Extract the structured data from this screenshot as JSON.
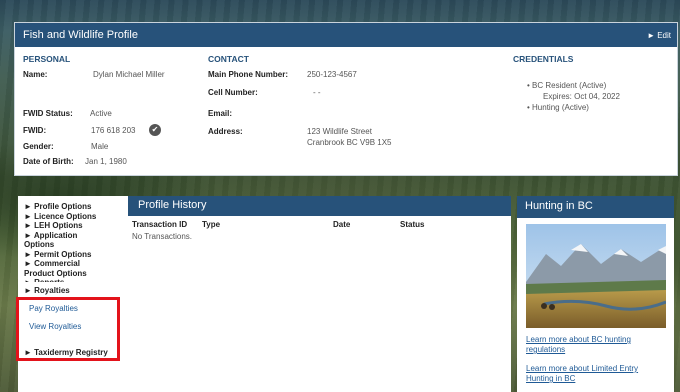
{
  "profile": {
    "title": "Fish and Wildlife Profile",
    "edit_label": "► Edit",
    "personal": {
      "heading": "PERSONAL",
      "name_label": "Name:",
      "name_value": "Dylan Michael Miller",
      "fwid_status_label": "FWID Status:",
      "fwid_status_value": "Active",
      "fwid_label": "FWID:",
      "fwid_value": "176 618 203",
      "gender_label": "Gender:",
      "gender_value": "Male",
      "dob_label": "Date of Birth:",
      "dob_value": "Jan 1, 1980"
    },
    "contact": {
      "heading": "CONTACT",
      "main_phone_label": "Main Phone Number:",
      "main_phone_value": "250-123-4567",
      "cell_label": "Cell Number:",
      "cell_value": "- -",
      "email_label": "Email:",
      "address_label": "Address:",
      "address_line1": "123 Wildlife Street",
      "address_line2": "Cranbrook BC V9B 1X5"
    },
    "credentials": {
      "heading": "CREDENTIALS",
      "item1": "• BC Resident (Active)",
      "item1_sub": "Expires: Oct 04, 2022",
      "item2": "• Hunting (Active)"
    }
  },
  "leftnav": {
    "profile_options": "► Profile Options",
    "licence_options": "► Licence Options",
    "leh_options": "► LEH Options",
    "application_options_1": "► Application",
    "application_options_2": "Options",
    "permit_options": "► Permit Options",
    "commercial_1": "► Commercial",
    "commercial_2": "Product Options",
    "reports": "► Reports",
    "royalties": "► Royalties",
    "pay_royalties": "Pay Royalties",
    "view_royalties": "View Royalties",
    "taxidermy": "► Taxidermy Registry"
  },
  "history": {
    "title": "Profile History",
    "col_transaction_id": "Transaction ID",
    "col_type": "Type",
    "col_date": "Date",
    "col_status": "Status",
    "empty_text": "No Transactions."
  },
  "hunting": {
    "title": "Hunting in BC",
    "link1_line1": "Learn more about BC hunting",
    "link1_line2": "regulations",
    "link2_line1": "Learn more about Limited Entry",
    "link2_line2": "Hunting in BC"
  },
  "colors": {
    "header_blue": "#27527a",
    "link_blue": "#1f5a96",
    "highlight_red": "#e3131b"
  }
}
